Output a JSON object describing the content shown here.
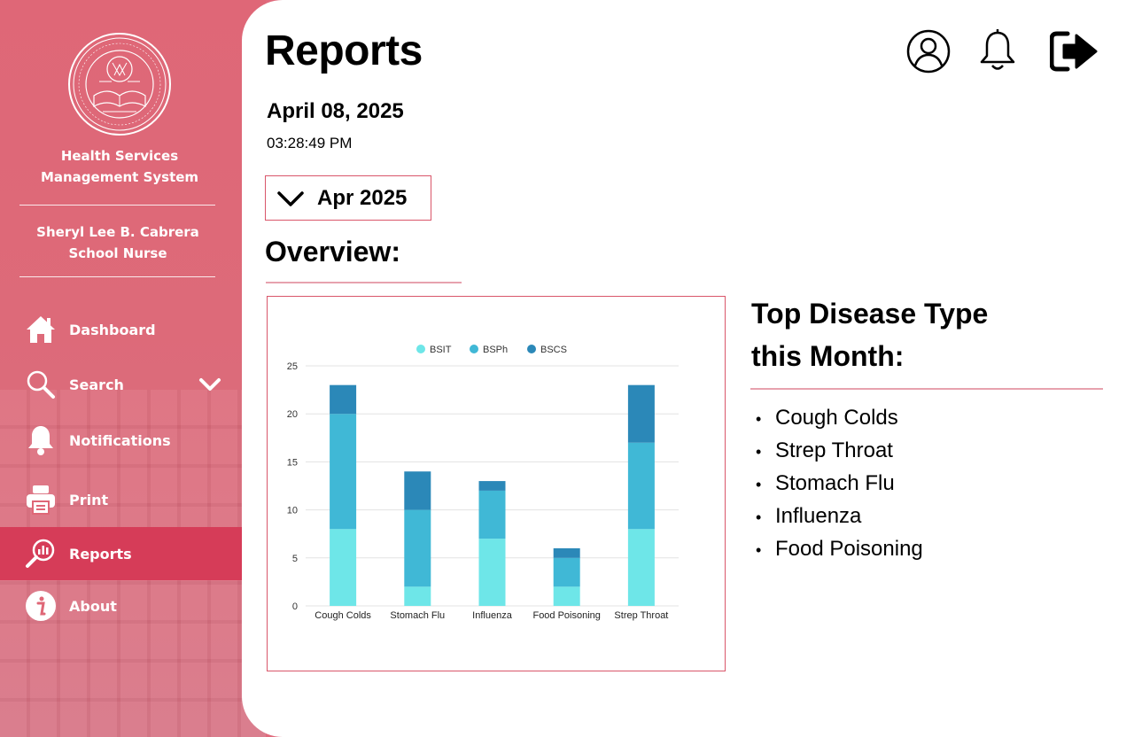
{
  "sidebar": {
    "system_name_line1": "Health Services",
    "system_name_line2": "Management System",
    "user_name": "Sheryl Lee B. Cabrera",
    "user_role": "School Nurse",
    "logo_text": "UNIVERSITY OF THE IMMACULATE CONCEPTION · DAVAO · 1905 · CITY",
    "items": [
      {
        "label": "Dashboard",
        "icon": "home-icon"
      },
      {
        "label": "Search",
        "icon": "search-icon"
      },
      {
        "label": "Notifications",
        "icon": "bell-icon"
      },
      {
        "label": "Print",
        "icon": "printer-icon"
      },
      {
        "label": "Reports",
        "icon": "reports-icon",
        "active": true
      },
      {
        "label": "About",
        "icon": "info-icon"
      }
    ]
  },
  "header": {
    "title": "Reports",
    "date": "April 08, 2025",
    "time": "03:28:49 PM",
    "icons": [
      "profile-icon",
      "bell-icon",
      "logout-icon"
    ]
  },
  "filter": {
    "month": "Apr 2025"
  },
  "overview": {
    "label": "Overview:"
  },
  "top_diseases": {
    "title_line1": "Top Disease Type",
    "title_line2": "this Month:",
    "items": [
      "Cough Colds",
      "Strep Throat",
      "Stomach Flu",
      "Influenza",
      "Food Poisoning"
    ]
  },
  "colors": {
    "sidebar": "#df6777",
    "active": "#d63c58",
    "BSIT": "#6ee6e8",
    "BSPh": "#40b8d6",
    "BSCS": "#2b88b8"
  },
  "chart_data": {
    "type": "bar",
    "stacked": true,
    "categories": [
      "Cough Colds",
      "Stomach Flu",
      "Influenza",
      "Food Poisoning",
      "Strep Throat"
    ],
    "series": [
      {
        "name": "BSIT",
        "values": [
          8,
          2,
          7,
          2,
          8
        ]
      },
      {
        "name": "BSPh",
        "values": [
          12,
          8,
          5,
          3,
          9
        ]
      },
      {
        "name": "BSCS",
        "values": [
          3,
          4,
          1,
          1,
          6
        ]
      }
    ],
    "ylim": [
      0,
      25
    ],
    "yticks": [
      0,
      5,
      10,
      15,
      20,
      25
    ],
    "grid": true,
    "legend": "top"
  }
}
